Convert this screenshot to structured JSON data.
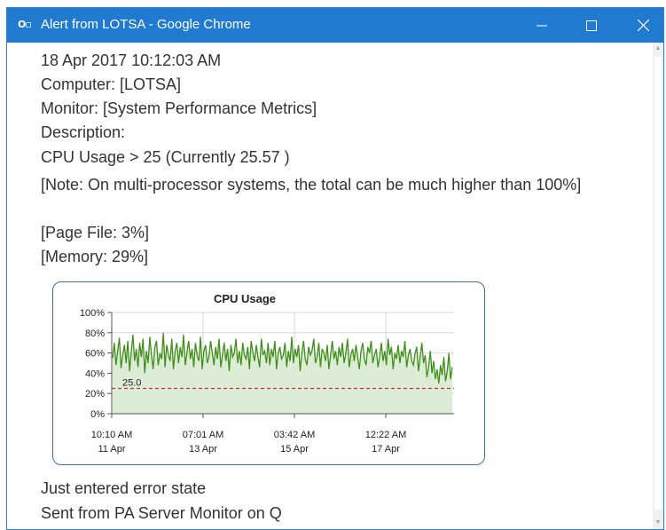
{
  "window": {
    "title": "Alert from LOTSA - Google Chrome",
    "icon": "outlook-icon",
    "icon_text": "O▫",
    "titlebar_color": "#1f7ad0",
    "controls": [
      "minimize",
      "maximize",
      "close"
    ]
  },
  "alert": {
    "timestamp": "18 Apr 2017 10:12:03 AM",
    "computer": "Computer: [LOTSA]",
    "monitor": "Monitor: [System Performance Metrics]",
    "description_label": "Description:",
    "cpu_line": "CPU Usage > 25 (Currently 25.57 )",
    "note": "[Note: On multi-processor systems, the total can be much higher than 100%]",
    "page_file": "[Page File: 3%]",
    "memory": "[Memory: 29%]",
    "state": "Just entered error state",
    "sent_from": "Sent from PA Server Monitor on Q"
  },
  "chart_data": {
    "type": "line",
    "title": "CPU Usage",
    "ylim": [
      0,
      100
    ],
    "y_ticks": [
      "100%",
      "80%",
      "60%",
      "40%",
      "20%",
      "0%"
    ],
    "x_ticks": [
      {
        "time": "10:10 AM",
        "date": "11 Apr"
      },
      {
        "time": "07:01 AM",
        "date": "13 Apr"
      },
      {
        "time": "03:42 AM",
        "date": "15 Apr"
      },
      {
        "time": "12:22 AM",
        "date": "17 Apr"
      }
    ],
    "threshold": {
      "value": 25,
      "label": "25.0",
      "color": "#c0392b"
    },
    "series": [
      {
        "color": "#3f8f1a",
        "fill": "#dcecd6",
        "values": [
          55,
          70,
          48,
          62,
          75,
          45,
          58,
          68,
          50,
          72,
          42,
          60,
          78,
          52,
          64,
          46,
          70,
          56,
          74,
          40,
          62,
          50,
          76,
          58,
          44,
          66,
          72,
          48,
          60,
          54,
          80,
          46,
          68,
          58,
          52,
          74,
          44,
          62,
          70,
          50,
          66,
          56,
          78,
          48,
          60,
          72,
          54,
          64,
          46,
          70,
          58,
          52,
          76,
          44,
          62,
          68,
          50,
          56,
          72,
          60,
          48,
          66,
          54,
          74,
          46,
          58,
          70,
          52,
          64,
          42,
          68,
          56,
          60,
          74,
          50,
          62,
          48,
          70,
          58,
          54,
          66,
          44,
          72,
          60,
          52,
          68,
          56,
          46,
          74,
          58,
          62,
          50,
          70,
          48,
          64,
          56,
          72,
          44,
          60,
          66,
          54,
          58,
          70,
          46,
          62,
          52,
          76,
          50,
          64,
          56,
          68,
          42,
          60,
          72,
          54,
          48,
          66,
          58,
          62,
          74,
          50,
          56,
          70,
          46,
          64,
          60,
          52,
          68,
          44,
          58,
          72,
          54,
          62,
          48,
          66,
          56,
          70,
          50,
          60,
          74,
          46,
          58,
          64,
          52,
          68,
          56,
          44,
          62,
          70,
          54,
          48,
          66,
          60,
          72,
          50,
          58,
          64,
          46,
          56,
          70,
          52,
          62,
          48,
          74,
          58,
          66,
          44,
          60,
          54,
          68,
          50,
          62,
          56,
          72,
          46,
          58,
          64,
          52,
          48,
          60,
          66,
          42,
          56,
          70,
          50,
          58,
          36,
          46,
          62,
          40,
          52,
          34,
          44,
          30,
          48,
          38,
          56,
          32,
          42,
          60,
          34,
          46
        ]
      }
    ]
  }
}
